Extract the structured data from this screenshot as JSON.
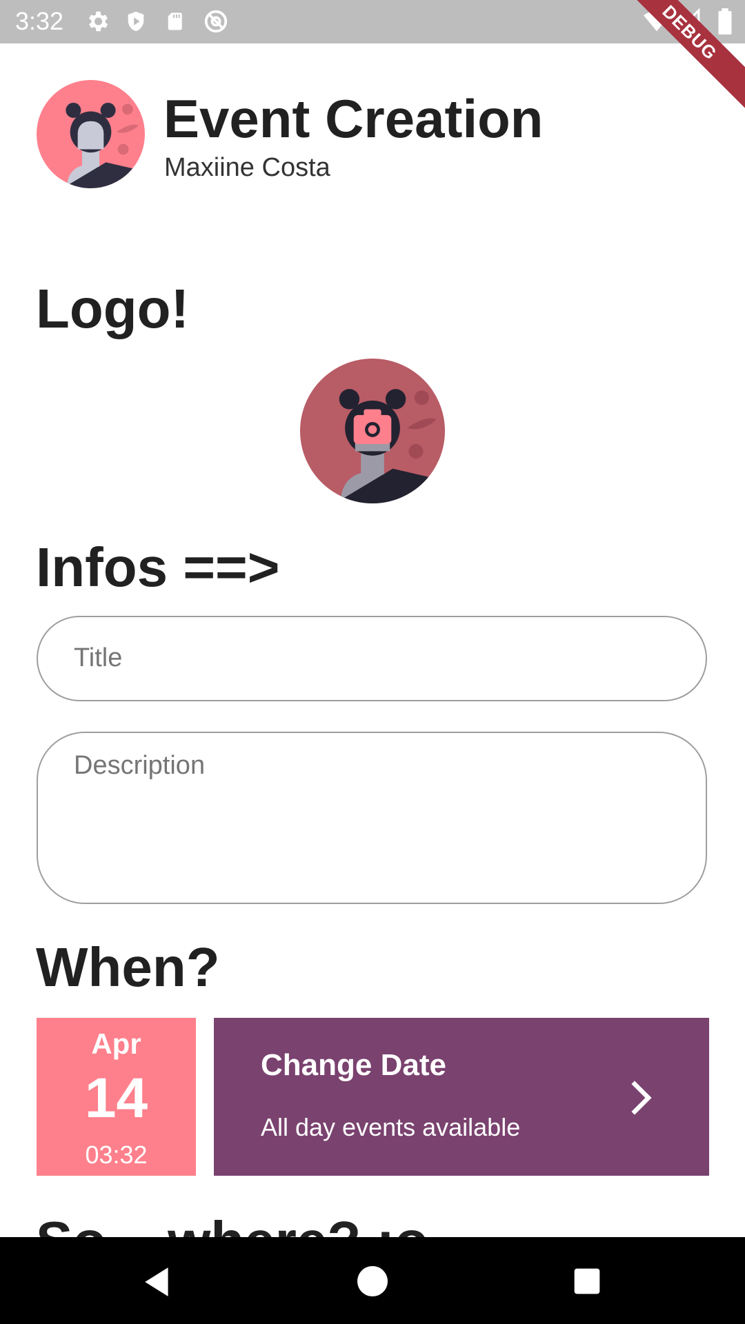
{
  "status_bar": {
    "time": "3:32",
    "left_icons": [
      "settings-icon",
      "shield-icon",
      "sd-card-icon",
      "no-location-icon"
    ],
    "right_icons": [
      "wifi-icon",
      "signal-icon",
      "battery-icon"
    ],
    "debug_label": "DEBUG"
  },
  "header": {
    "title": "Event Creation",
    "subtitle": "Maxiine Costa"
  },
  "sections": {
    "logo": "Logo!",
    "infos": "Infos ==>",
    "when": "When?",
    "where": "So... where? :o"
  },
  "form": {
    "title_placeholder": "Title",
    "description_placeholder": "Description"
  },
  "date": {
    "month": "Apr",
    "day": "14",
    "time": "03:32"
  },
  "change_date": {
    "title": "Change Date",
    "subtitle": "All day events available"
  },
  "nav": {
    "icons": [
      "back-icon",
      "home-icon",
      "recents-icon"
    ]
  },
  "colors": {
    "accent_pink": "#fe808c",
    "accent_purple": "#7a426f",
    "avatar_logo_bg": "#b85c66",
    "debug_ribbon": "#a8323e"
  }
}
